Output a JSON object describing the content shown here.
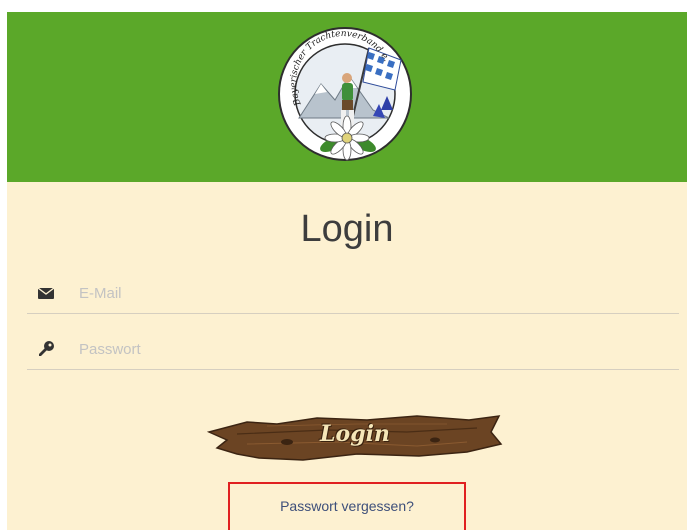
{
  "header": {
    "logo_text": "Bayerischer Trachtenverband e.V.",
    "colors": {
      "header_bg": "#5ba829",
      "page_bg": "#fdf1d1"
    }
  },
  "login_form": {
    "title": "Login",
    "email": {
      "placeholder": "E-Mail",
      "value": "",
      "icon": "envelope-icon"
    },
    "password": {
      "placeholder": "Passwort",
      "value": "",
      "icon": "key-icon"
    },
    "submit_label": "Login",
    "forgot_label": "Passwort vergessen?"
  }
}
